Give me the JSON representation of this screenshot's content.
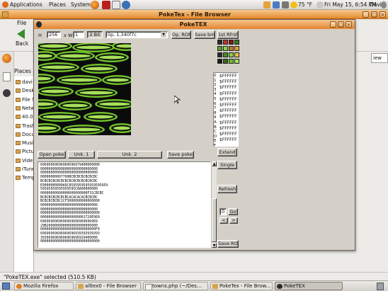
{
  "top_panel": {
    "menus": [
      "Applications",
      "Places",
      "System"
    ],
    "temperature": "75 °F",
    "datetime": "Fri May 15,  6:54 PM",
    "user": "David"
  },
  "file_browser": {
    "title": "PokeTex - File Browser",
    "menu_file": "File",
    "back_label": "Back",
    "places_header": "Places",
    "view_combo": "iew",
    "sidebar_items": [
      "davi",
      "Desk",
      "File S",
      "Netw",
      "40.0",
      "Trash",
      "Docu",
      "Musi",
      "Pictu",
      "Vide",
      "iTune",
      "Temp"
    ],
    "status": "\"PokeTEX.exe\" selected (510.5 KB)"
  },
  "poketex": {
    "title": "PokeTEX",
    "h_label": "H",
    "h_value": "256",
    "x_label": "x",
    "w_label": "W",
    "w_value": "1",
    "bpp_btn": "2 Bit",
    "offset_value": "0p, 1,340f7c",
    "op_rom_btn": "Op. ROM",
    "save_bmp_btn": "Save bmp",
    "rfrsh_btn": "1st Rfrsh",
    "color_digits": [
      "0",
      "1",
      "2",
      "3",
      "4",
      "5",
      "6",
      "7",
      "8",
      "9",
      "A",
      "B",
      "C",
      "D",
      "E",
      "F"
    ],
    "colors": [
      "$FFFFFF",
      "$FFFFFF",
      "$FFFFFF",
      "$FFFFFF",
      "$FFFFFF",
      "$FFFFFF",
      "$FFFFFF",
      "$FFFFFF",
      "$FFFFFF",
      "$FFFFFF",
      "$FFFFFF",
      "$FFFFFF"
    ],
    "open_poke_btn": "Open poke",
    "unk1_btn": "Unk. 1",
    "unk2_btn": "Unk. 2",
    "save_poke_btn": "Save poke",
    "extend_btn": "Extend",
    "single_btn": "Single",
    "refresh_btn": "Refresh",
    "go_value": "0",
    "go_btn": "Go",
    "prev_btn": "<",
    "next_btn": ">",
    "save_rom_btn": "Save ROM",
    "hex_lines": [
      "69696969696969696979400000000",
      "0000000000000000000000000000",
      "0000000000000000000000000000",
      "00000000007709BCBCBCBCBCBCBC",
      "BCBCBCBCBCBCBCBCBCBCBCBCBCBC",
      "E9000000000A9C8595959595959595959",
      "59595959595959595C8A00000000",
      "00000000000000000000000F31CBCBC",
      "BCBCBCBCBCBCBCACACACACBCBCBC",
      "BCBCBCBCBC1CF3000000000000000",
      "0000000000000000000000000000",
      "0000000000000000000000000000",
      "00000000000000000000000000000",
      "0000000000000000000001729E969",
      "6969696969696969696969696969",
      "29B2000000000000000000000000",
      "000000000000000000000000000F0",
      "69696969696969696939393939393",
      "3939696969696969696929400000",
      "00000000000000000000000000000"
    ]
  },
  "taskbar": {
    "tasks": [
      "Mozilla Firefox",
      "alltex0 - File Browser",
      "towns.php (~/Des...",
      "PokeTex - File Brow...",
      "PokeTEX"
    ]
  },
  "colors": {
    "title_bar": "#e48a2e",
    "texture_green": "#6fbf2a",
    "texture_lime": "#a6e05a",
    "texture_black": "#0b0b0b"
  }
}
